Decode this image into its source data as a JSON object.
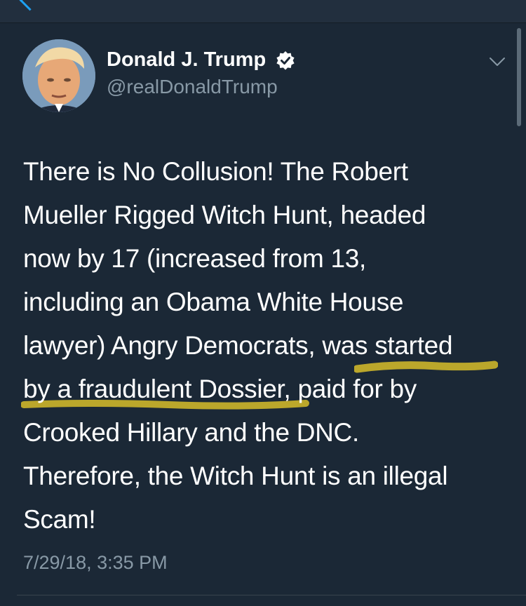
{
  "tweet": {
    "author": {
      "name": "Donald J. Trump",
      "handle": "@realDonaldTrump",
      "verified": true
    },
    "text_lines": [
      "There is No Collusion! The Robert",
      "Mueller Rigged Witch Hunt, headed",
      "now by 17 (increased from 13,",
      "including an Obama White House",
      "lawyer) Angry Democrats, was started",
      "by a fraudulent Dossier, paid for by",
      "Crooked Hillary and the DNC.",
      "Therefore, the Witch Hunt is an illegal",
      "Scam!"
    ],
    "highlighted_phrase": "was started by a fraudulent Dossier",
    "timestamp": "7/29/18, 3:35 PM"
  },
  "icons": {
    "back": "chevron-left-icon",
    "verified": "verified-badge-icon",
    "menu": "chevron-down-icon"
  },
  "colors": {
    "background": "#1b2836",
    "text": "#ffffff",
    "secondary_text": "#8899a6",
    "accent": "#1da1f2",
    "highlight": "#c9b22a"
  }
}
